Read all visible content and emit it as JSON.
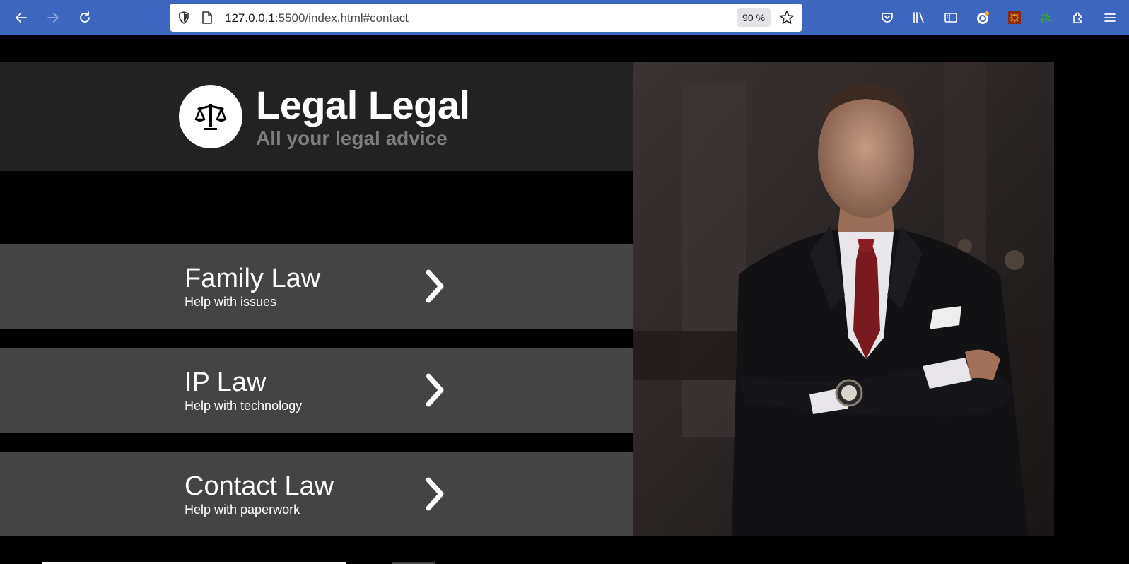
{
  "browser": {
    "url_host": "127.0.0.1",
    "url_rest": ":5500/index.html#contact",
    "zoom": "90 %",
    "icons": [
      "back-icon",
      "forward-icon",
      "reload-icon",
      "shield-icon",
      "page-icon",
      "bookmark-star-icon",
      "pocket-icon",
      "library-icon",
      "sidebar-icon",
      "account-icon",
      "extension-sun-icon",
      "extension-hashtag-icon",
      "extensions-icon",
      "menu-icon"
    ],
    "accent": "#3d67be"
  },
  "header": {
    "title": "Legal Legal",
    "subtitle": "All your legal advice",
    "logo_icon": "scales-icon"
  },
  "services": [
    {
      "title": "Family Law",
      "desc": "Help with issues"
    },
    {
      "title": "IP Law",
      "desc": "Help with technology"
    },
    {
      "title": "Contact Law",
      "desc": "Help with paperwork"
    }
  ],
  "colors": {
    "header_band": "#222222",
    "service_band": "#444444",
    "subtitle": "#7d7d7d"
  }
}
